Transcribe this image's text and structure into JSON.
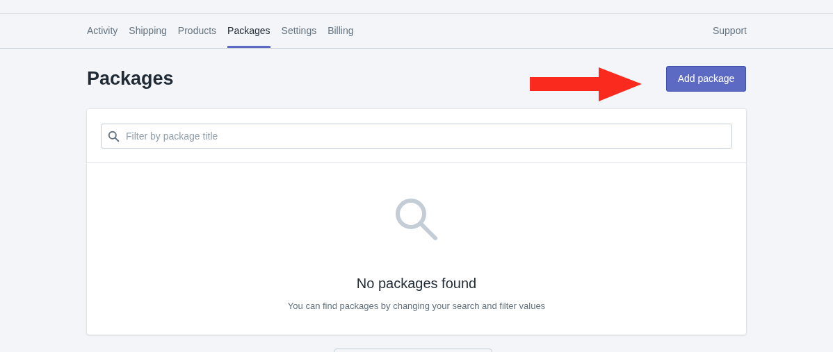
{
  "nav": {
    "tabs": [
      {
        "label": "Activity",
        "selected": false
      },
      {
        "label": "Shipping",
        "selected": false
      },
      {
        "label": "Products",
        "selected": false
      },
      {
        "label": "Packages",
        "selected": true
      },
      {
        "label": "Settings",
        "selected": false
      },
      {
        "label": "Billing",
        "selected": false
      }
    ],
    "support_link": "Support"
  },
  "page": {
    "title": "Packages",
    "primary_button": "Add package"
  },
  "filter": {
    "placeholder": "Filter by package title"
  },
  "empty_state": {
    "heading": "No packages found",
    "message": "You can find packages by changing your search and filter values"
  }
}
